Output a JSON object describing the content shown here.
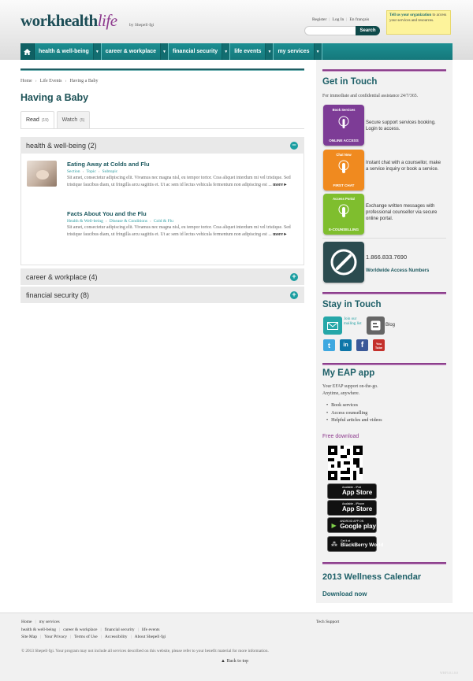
{
  "brand": {
    "logo_part1": "work",
    "logo_part2": "health",
    "logo_part3": "life",
    "byline": "by Shepell·fgi"
  },
  "header": {
    "links": [
      "Register",
      "Log In",
      "En français"
    ],
    "search": {
      "placeholder": "",
      "button": "Search"
    },
    "promo": {
      "bold": "Tell us your organization",
      "rest": " to access your services and resources."
    }
  },
  "nav": {
    "home_icon": "home-icon",
    "items": [
      "health & well-being",
      "career & workplace",
      "financial security",
      "life events",
      "my services"
    ]
  },
  "breadcrumb": [
    "Home",
    "Life Events",
    "Having a Baby"
  ],
  "page": {
    "title": "Having a Baby"
  },
  "tabs": [
    {
      "label": "Read",
      "count": "(19)"
    },
    {
      "label": "Watch",
      "count": "(5)"
    }
  ],
  "accordion": [
    {
      "label": "health & well-being (2)",
      "state": "−"
    },
    {
      "label": "career & workplace (4)",
      "state": "+"
    },
    {
      "label": "financial security (8)",
      "state": "+"
    }
  ],
  "articles": [
    {
      "title": "Eating Away at Colds and Flu",
      "tags": [
        "Section",
        "Topic",
        "Subtopic"
      ],
      "text": "Sit amet, consectetur adipiscing elit. Vivamus nec magna nisl, eu tempor tortor. Cras aliquet interdum mi vel tristique. Sed tristique faucibus diam, ut fringilla arcu sagittis et. Ut ac sem id lectus vehicula fermentum non adipiscing est ...",
      "more": "more ▸"
    },
    {
      "title": "Facts About You and the Flu",
      "tags": [
        "Health & Well-being",
        "Disease & Conditions",
        "Cold & Flu"
      ],
      "text": "Sit amet, consectetur adipiscing elit. Vivamus nec magna nisl, eu tempor tortor. Cras aliquet interdum mi vel tristique. Sed tristique faucibus diam, ut fringilla arcu sagittis et. Ut ac sem id lectus vehicula fermentum non adipiscing est ...",
      "more": "more ▸"
    }
  ],
  "sidebar": {
    "get_in_touch": {
      "heading": "Get in Touch",
      "sub": "For immediate and confidential assistance 24/7/365.",
      "services": [
        {
          "top": "Book Services",
          "bottom": "ONLINE ACCESS",
          "desc": "Secure support services booking. Login to access.",
          "color": "#7d3c96"
        },
        {
          "top": "Chat Now",
          "bottom": "FIRST CHAT",
          "desc": "Instant chat with a counsellor, make a service inquiry or book a service.",
          "color": "#f08a1f"
        },
        {
          "top": "Access Portal",
          "bottom": "E-COUNSELLING",
          "desc": "Exchange written messages with professional counsellor via secure online portal.",
          "color": "#7fbe2e"
        }
      ],
      "phone": "1.866.833.7690",
      "worldwide": "Worldwide Access Numbers"
    },
    "stay_in_touch": {
      "heading": "Stay in Touch",
      "mailing": "Join our mailing list",
      "blog": "Blog",
      "social": [
        "twitter-icon",
        "linkedin-icon",
        "facebook-icon",
        "youtube-icon"
      ]
    },
    "eap": {
      "heading": "My EAP app",
      "line1": "Your EFAP support on-the-go.",
      "line2": "Anytime, anywhere.",
      "bullets": [
        "Book services",
        "Access counselling",
        "Helpful articles and videos"
      ],
      "free_download": "Free download",
      "stores": [
        {
          "small": "Available - iPad",
          "big": "App Store",
          "icon": ""
        },
        {
          "small": "Available - iPhone",
          "big": "App Store",
          "icon": ""
        },
        {
          "small": "ANDROID APP ON",
          "big": "Google play",
          "icon": "▶"
        },
        {
          "small": "Get it at",
          "big": "BlackBerry World",
          "icon": "⁂"
        }
      ]
    },
    "calendar": {
      "heading": "2013 Wellness Calendar",
      "download": "Download now"
    }
  },
  "footer": {
    "row1": [
      "Home",
      "my services"
    ],
    "row2": [
      "health & well-being",
      "career & workplace",
      "financial security",
      "life events"
    ],
    "row3": [
      "Site Map",
      "Your Privacy",
      "Terms of Use",
      "Accessibility",
      "About Shepell·fgi"
    ],
    "tech": "Tech Support",
    "copyright": "© 2013 Shepell·fgi. Your program may not include all services described on this website, please refer to your benefit material for more information.",
    "backtop": "Back to top",
    "version": "WHF5.0.1.0.0"
  }
}
